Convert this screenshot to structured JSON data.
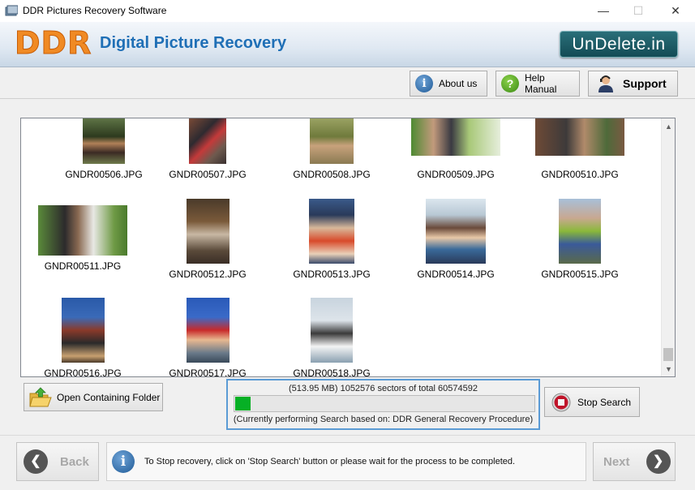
{
  "window": {
    "title": "DDR Pictures Recovery Software",
    "minimize": "—",
    "maximize": "☐",
    "close": "✕"
  },
  "header": {
    "logo": "DDR",
    "subtitle": "Digital Picture Recovery",
    "brand": "UnDelete.in"
  },
  "toolbar": {
    "about_label": "About us",
    "help_label": "Help Manual",
    "support_label": "Support"
  },
  "thumbnails": [
    {
      "label": "GNDR00506.JPG"
    },
    {
      "label": "GNDR00507.JPG"
    },
    {
      "label": "GNDR00508.JPG"
    },
    {
      "label": "GNDR00509.JPG"
    },
    {
      "label": "GNDR00510.JPG"
    },
    {
      "label": "GNDR00511.JPG"
    },
    {
      "label": "GNDR00512.JPG"
    },
    {
      "label": "GNDR00513.JPG"
    },
    {
      "label": "GNDR00514.JPG"
    },
    {
      "label": "GNDR00515.JPG"
    },
    {
      "label": "GNDR00516.JPG"
    },
    {
      "label": "GNDR00517.JPG"
    },
    {
      "label": "GNDR00518.JPG"
    }
  ],
  "open_folder_label": "Open Containing Folder",
  "progress": {
    "line1": "(513.95 MB) 1052576  sectors  of  total 60574592",
    "fraction": 0.0174,
    "line2": "(Currently performing Search based on:  DDR General Recovery Procedure)"
  },
  "stop_label": "Stop Search",
  "bottom": {
    "back_label": "Back",
    "next_label": "Next",
    "info_text": "To Stop recovery, click on 'Stop Search' button or please wait for the process to be completed."
  },
  "icons": {
    "about": "info-icon",
    "help": "question-icon",
    "support": "support-person-icon",
    "folder": "folder-open-icon",
    "stop": "stop-icon",
    "back": "back-arrow-icon",
    "next": "next-arrow-icon",
    "info": "info-icon"
  },
  "colors": {
    "accent": "#1f6fb6",
    "logo": "#f08a24",
    "progress": "#06b025",
    "stop": "#c0142a",
    "highlight": "#5b9bd5"
  }
}
